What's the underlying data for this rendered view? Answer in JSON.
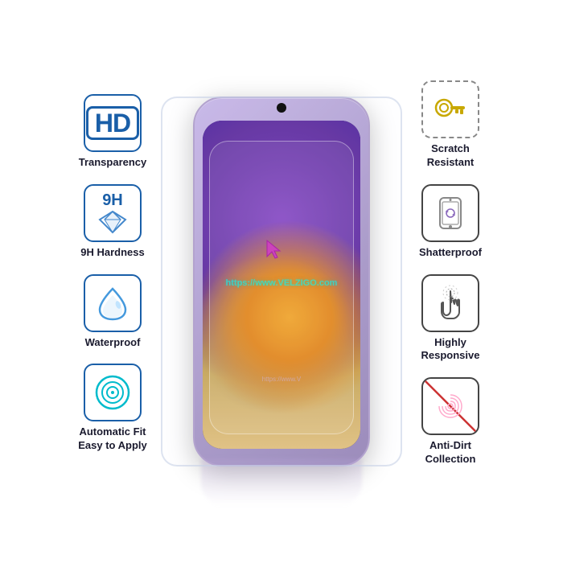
{
  "features_left": [
    {
      "id": "hd-transparency",
      "icon_type": "hd",
      "label": "Transparency"
    },
    {
      "id": "9h-hardness",
      "icon_type": "9h",
      "label": "9H Hardness"
    },
    {
      "id": "waterproof",
      "icon_type": "water",
      "label": "Waterproof"
    },
    {
      "id": "auto-fit",
      "icon_type": "target",
      "label": "Automatic Fit\nEasy to Apply"
    }
  ],
  "features_right": [
    {
      "id": "scratch-resistant",
      "icon_type": "key",
      "label": "Scratch\nResistant"
    },
    {
      "id": "shatterproof",
      "icon_type": "phone-shield",
      "label": "Shatterproof"
    },
    {
      "id": "highly-responsive",
      "icon_type": "touch",
      "label": "Highly\nResponsive"
    },
    {
      "id": "anti-dirt",
      "icon_type": "fingerprint",
      "label": "Anti-Dirt\nCollection"
    }
  ],
  "watermark": "https://www.VELZIGO.com",
  "watermark2": "https://www.V",
  "brand": "VELZIGO"
}
